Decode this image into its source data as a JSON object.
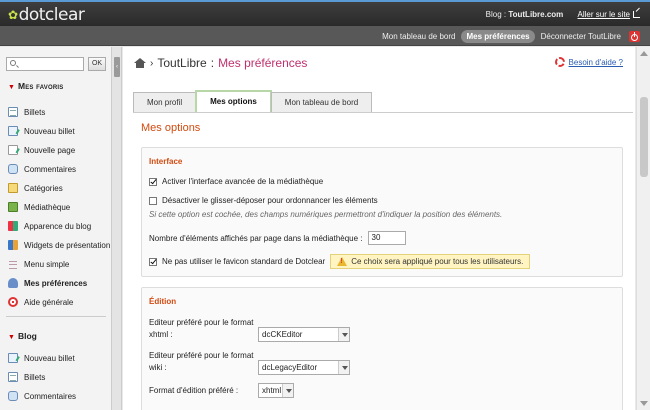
{
  "app": {
    "logo": "dotclear",
    "blog_prefix": "Blog :",
    "blog_name": "ToutLibre.com",
    "go_site": "Aller sur le site"
  },
  "topnav": {
    "dashboard": "Mon tableau de bord",
    "preferences": "Mes préférences",
    "logout": "Déconnecter ToutLibre"
  },
  "sidebar": {
    "search_placeholder": "",
    "ok": "OK",
    "favorites_title": "Mes favoris",
    "favorites": [
      {
        "label": "Billets",
        "icon": "posts-icon"
      },
      {
        "label": "Nouveau billet",
        "icon": "new-post-icon"
      },
      {
        "label": "Nouvelle page",
        "icon": "new-page-icon"
      },
      {
        "label": "Commentaires",
        "icon": "comments-icon"
      },
      {
        "label": "Catégories",
        "icon": "categories-icon"
      },
      {
        "label": "Médiathèque",
        "icon": "media-icon"
      },
      {
        "label": "Apparence du blog",
        "icon": "appearance-icon"
      },
      {
        "label": "Widgets de présentation",
        "icon": "widgets-icon"
      },
      {
        "label": "Menu simple",
        "icon": "menu-icon"
      },
      {
        "label": "Mes préférences",
        "icon": "user-prefs-icon"
      },
      {
        "label": "Aide générale",
        "icon": "help-icon"
      }
    ],
    "blog_title": "Blog",
    "blog_items": [
      {
        "label": "Nouveau billet",
        "icon": "new-post-icon"
      },
      {
        "label": "Billets",
        "icon": "posts-icon"
      },
      {
        "label": "Commentaires",
        "icon": "comments-icon"
      }
    ]
  },
  "main": {
    "breadcrumb_site": "ToutLibre",
    "breadcrumb_sep": ":",
    "breadcrumb_page": "Mes préférences",
    "help": "Besoin d'aide ?",
    "tabs": [
      "Mon profil",
      "Mes options",
      "Mon tableau de bord"
    ],
    "section_title": "Mes options",
    "interface": {
      "title": "Interface",
      "opt1": "Activer l'interface avancée de la médiathèque",
      "opt2": "Désactiver le glisser-déposer pour ordonnancer les éléments",
      "note": "Si cette option est cochée, des champs numériques permettront d'indiquer la position des éléments.",
      "per_page_label": "Nombre d'éléments affichés par page dans la médiathèque :",
      "per_page_value": "30",
      "opt3": "Ne pas utiliser le favicon standard de Dotclear",
      "warning": "Ce choix sera appliqué pour tous les utilisateurs."
    },
    "edition": {
      "title": "Édition",
      "xhtml_label": "Editeur préféré pour le format xhtml :",
      "xhtml_value": "dcCKEditor",
      "wiki_label": "Editeur préféré pour le format wiki :",
      "wiki_value": "dcLegacyEditor",
      "format_label": "Format d'édition préféré :",
      "format_value": "xhtml"
    }
  },
  "colors": {
    "accent_title": "#d24a0f",
    "page_pink": "#c0306d",
    "link": "#2a5db0"
  }
}
